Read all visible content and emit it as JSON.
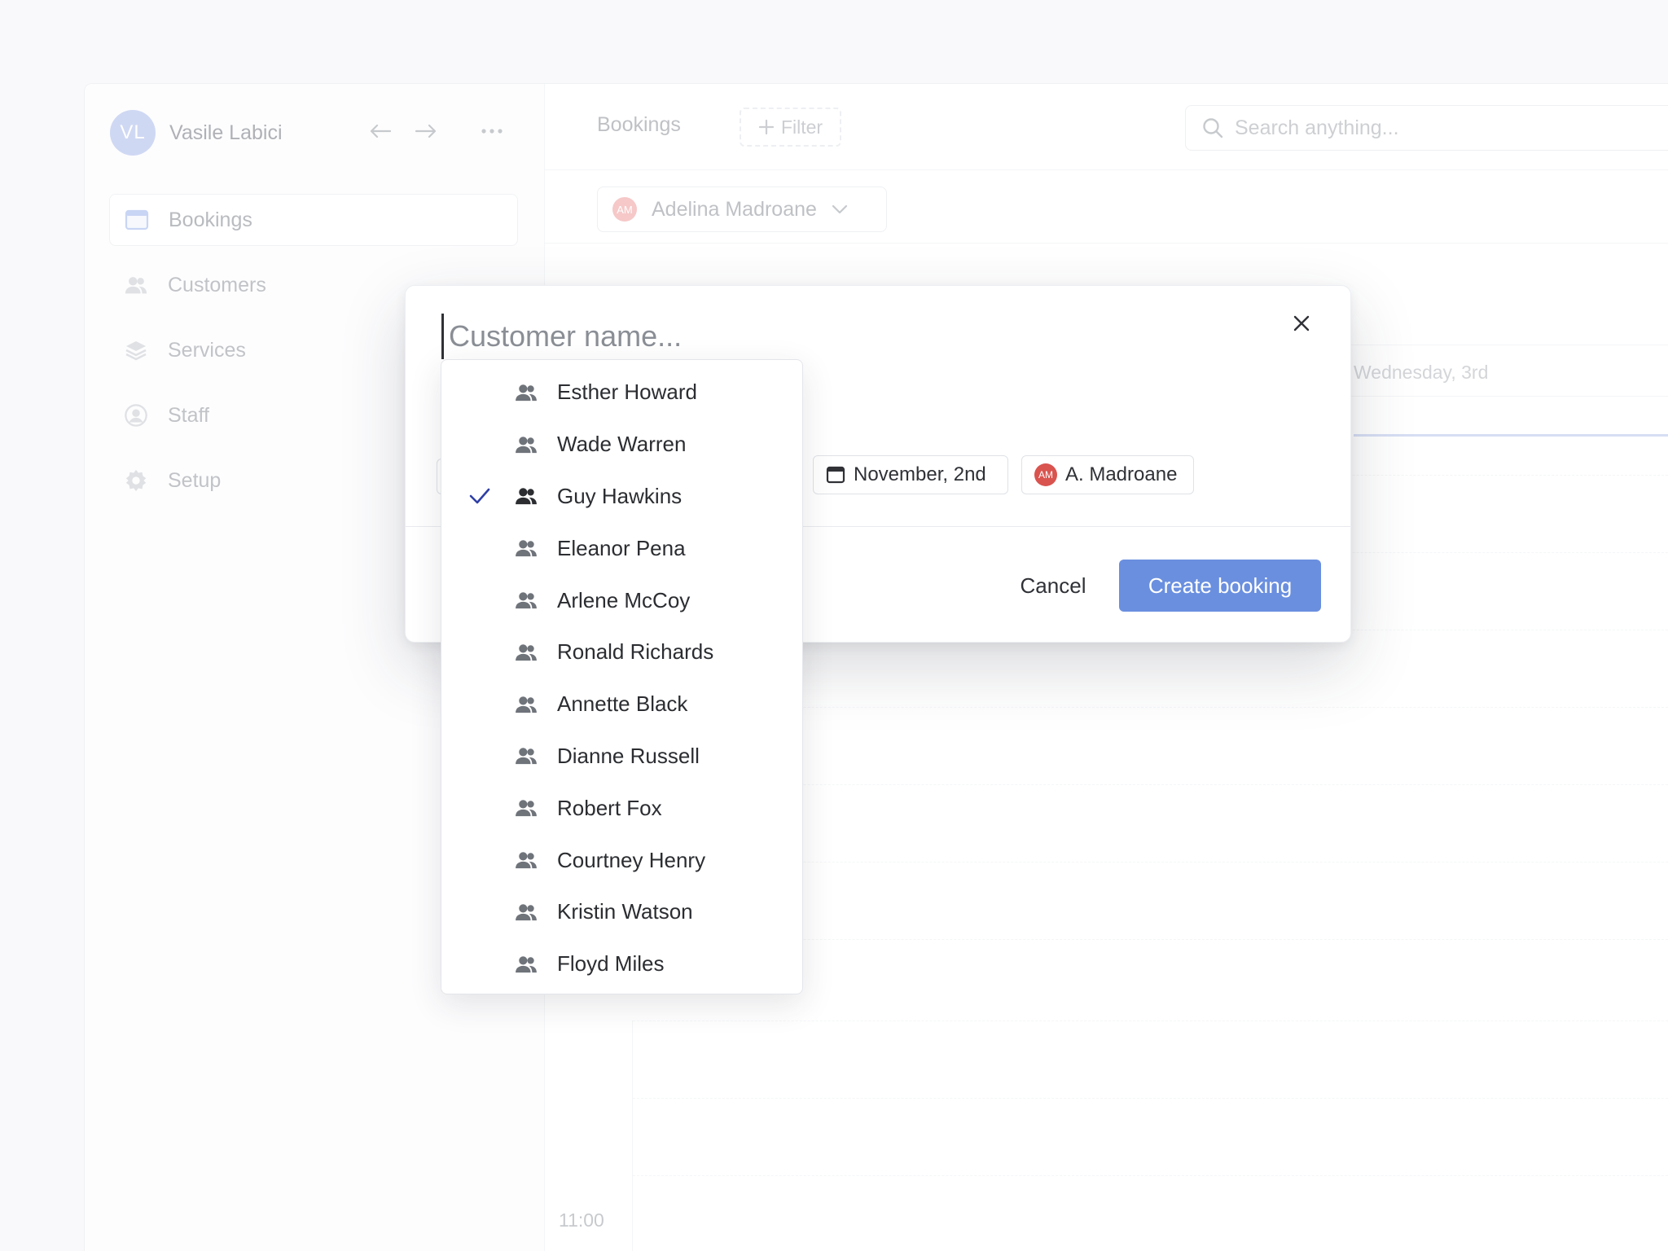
{
  "profile": {
    "initials": "VL",
    "name": "Vasile Labici"
  },
  "sidebar": {
    "items": [
      {
        "label": "Bookings",
        "icon": "calendar-icon",
        "active": true
      },
      {
        "label": "Customers",
        "icon": "users-icon",
        "active": false
      },
      {
        "label": "Services",
        "icon": "layers-icon",
        "active": false
      },
      {
        "label": "Staff",
        "icon": "user-circle-icon",
        "active": false
      },
      {
        "label": "Setup",
        "icon": "gear-icon",
        "active": false
      }
    ]
  },
  "topbar": {
    "title": "Bookings",
    "filter_label": "Filter",
    "search_placeholder": "Search anything..."
  },
  "staff_select": {
    "initials": "AM",
    "name": "Adelina Madroane"
  },
  "calendar": {
    "day_label": "Wednesday, 3rd",
    "time_label": "11:00"
  },
  "modal": {
    "name_placeholder": "Customer name...",
    "date_chip": "November, 2nd",
    "staff_chip_initials": "AM",
    "staff_chip": "A. Madroane",
    "cancel_label": "Cancel",
    "create_label": "Create booking"
  },
  "dropdown": {
    "selected": "Guy Hawkins",
    "customers": [
      "Esther Howard",
      "Wade Warren",
      "Guy Hawkins",
      "Eleanor Pena",
      "Arlene McCoy",
      "Ronald Richards",
      "Annette Black",
      "Dianne Russell",
      "Robert Fox",
      "Courtney Henry",
      "Kristin Watson",
      "Floyd Miles"
    ]
  },
  "colors": {
    "accent": "#6a8fdf",
    "avatar": "#a8b8ea",
    "staff_avatar": "#d9534f",
    "check": "#2f3fa6"
  }
}
